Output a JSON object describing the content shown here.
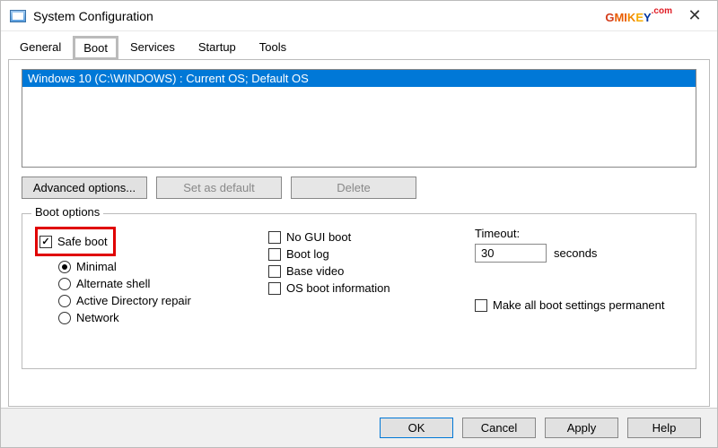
{
  "window": {
    "title": "System Configuration"
  },
  "brand": {
    "text_g": "G",
    "text_mi": "MI",
    "text_k": "K",
    "text_e": "E",
    "text_y": "Y",
    "text_com": ".com"
  },
  "tabs": {
    "general": "General",
    "boot": "Boot",
    "services": "Services",
    "startup": "Startup",
    "tools": "Tools"
  },
  "os_list": {
    "row0": "Windows 10 (C:\\WINDOWS) : Current OS; Default OS"
  },
  "buttons": {
    "advanced": "Advanced options...",
    "set_default": "Set as default",
    "delete": "Delete"
  },
  "group": {
    "legend": "Boot options"
  },
  "opts": {
    "safe_boot": "Safe boot",
    "minimal": "Minimal",
    "alt_shell": "Alternate shell",
    "ad_repair": "Active Directory repair",
    "network": "Network",
    "no_gui": "No GUI boot",
    "boot_log": "Boot log",
    "base_video": "Base video",
    "os_info": "OS boot information"
  },
  "timeout": {
    "label": "Timeout:",
    "value": "30",
    "unit": "seconds"
  },
  "perm": {
    "label": "Make all boot settings permanent"
  },
  "bottom": {
    "ok": "OK",
    "cancel": "Cancel",
    "apply": "Apply",
    "help": "Help"
  }
}
